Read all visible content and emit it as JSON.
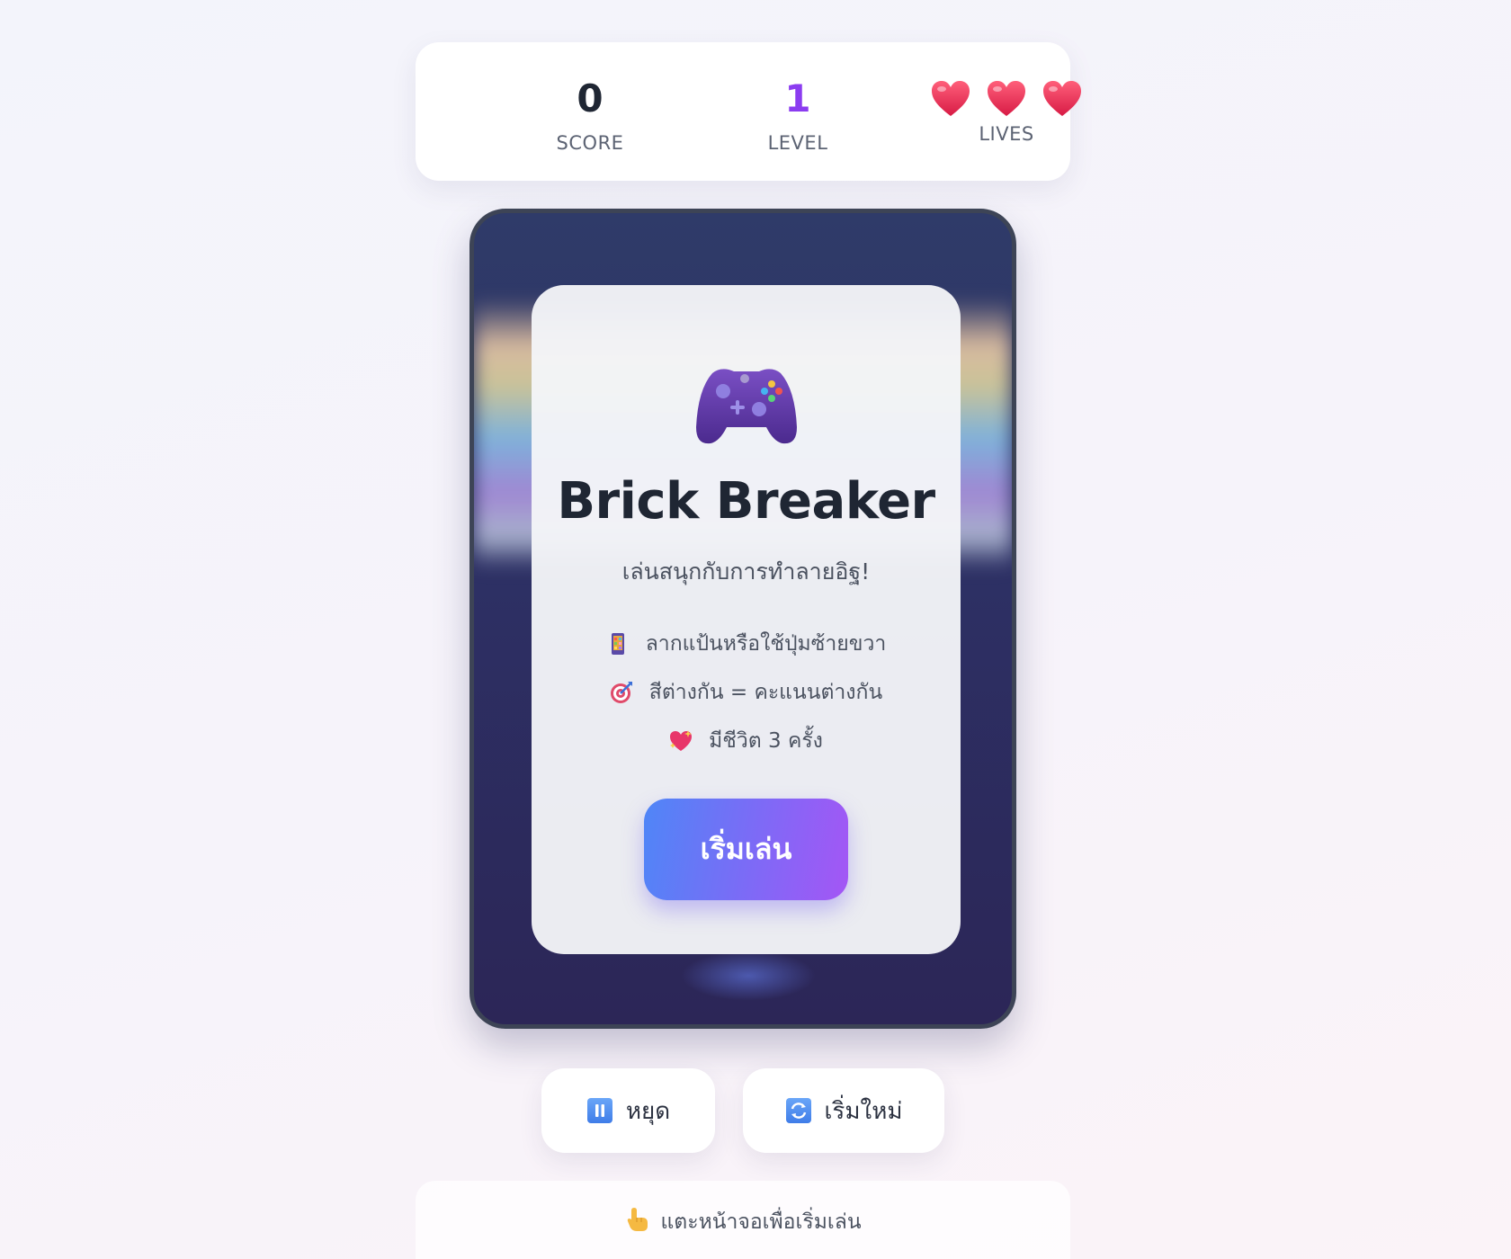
{
  "stats": {
    "score_value": "0",
    "score_label": "SCORE",
    "level_value": "1",
    "level_label": "LEVEL",
    "lives_count": 3,
    "lives_label": "LIVES"
  },
  "start_screen": {
    "icon": "game-controller-icon",
    "title": "Brick Breaker",
    "subtitle": "เล่นสนุกกับการทำลายอิฐ!",
    "rules": [
      {
        "icon": "mobile-phone-icon",
        "text": "ลากแป้นหรือใช้ปุ่มซ้ายขวา"
      },
      {
        "icon": "target-icon",
        "text": "สีต่างกัน = คะแนนต่างกัน"
      },
      {
        "icon": "sparkling-heart-icon",
        "text": "มีชีวิต 3 ครั้ง"
      }
    ],
    "start_button": "เริ่มเล่น"
  },
  "controls": {
    "pause_icon": "pause-icon",
    "pause_label": "หยุด",
    "restart_icon": "restart-icon",
    "restart_label": "เริ่มใหม่"
  },
  "hint": {
    "icon": "pointing-hand-icon",
    "text": "แตะหน้าจอเพื่อเริ่มเล่น"
  },
  "colors": {
    "level_accent": "#8b3cf0",
    "button_gradient_start": "#4f86f7",
    "button_gradient_end": "#a456f5",
    "board_background": "#2d3064"
  }
}
